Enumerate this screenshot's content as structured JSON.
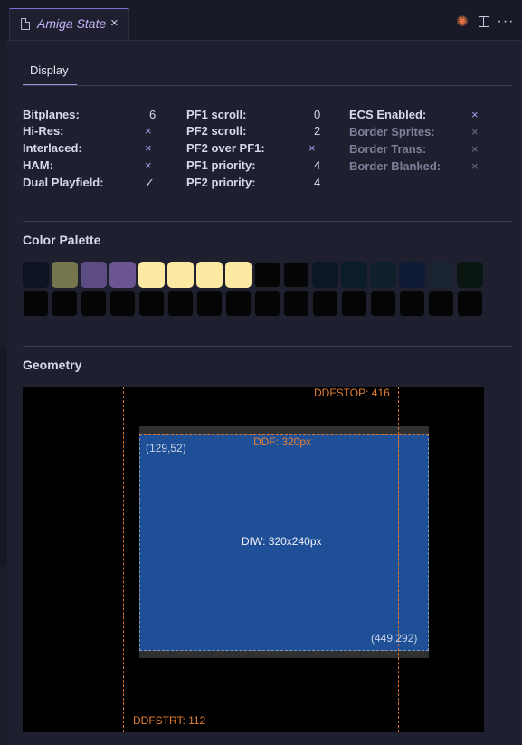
{
  "tab": {
    "title": "Amiga State",
    "close": "×"
  },
  "toolbar": {
    "spark": "✺",
    "more": "···"
  },
  "panel_tab": "Display",
  "display": {
    "col1": [
      {
        "label": "Bitplanes:",
        "value": "6",
        "kind": "text"
      },
      {
        "label": "Hi-Res:",
        "value": "×",
        "kind": "x"
      },
      {
        "label": "Interlaced:",
        "value": "×",
        "kind": "x"
      },
      {
        "label": "HAM:",
        "value": "×",
        "kind": "x"
      },
      {
        "label": "Dual Playfield:",
        "value": "✓",
        "kind": "check"
      }
    ],
    "col2": [
      {
        "label": "PF1 scroll:",
        "value": "0",
        "kind": "text"
      },
      {
        "label": "PF2 scroll:",
        "value": "2",
        "kind": "text"
      },
      {
        "label": "PF2 over PF1:",
        "value": "×",
        "kind": "x"
      },
      {
        "label": "PF1 priority:",
        "value": "4",
        "kind": "text"
      },
      {
        "label": "PF2 priority:",
        "value": "4",
        "kind": "text"
      }
    ],
    "col3": [
      {
        "label": "ECS Enabled:",
        "value": "×",
        "kind": "x",
        "dim": false
      },
      {
        "label": "Border Sprites:",
        "value": "×",
        "kind": "x",
        "dim": true
      },
      {
        "label": "Border Trans:",
        "value": "×",
        "kind": "x",
        "dim": true
      },
      {
        "label": "Border Blanked:",
        "value": "×",
        "kind": "x",
        "dim": true
      }
    ]
  },
  "palette": {
    "title": "Color Palette",
    "colors": [
      "#0d1320",
      "#75764e",
      "#5d4c84",
      "#6b5691",
      "#fce9a2",
      "#fce9a2",
      "#fce9a2",
      "#fce9a2",
      "#050505",
      "#050505",
      "#0b1824",
      "#0b1c2b",
      "#10202b",
      "#0f1a35",
      "#1a2531",
      "#0a1612",
      "#050505",
      "#050505",
      "#050505",
      "#050505",
      "#050505",
      "#050505",
      "#050505",
      "#050505",
      "#050505",
      "#050505",
      "#050505",
      "#050505",
      "#050505",
      "#050505",
      "#050505",
      "#050505"
    ]
  },
  "geometry": {
    "title": "Geometry",
    "ddfstop_label": "DDFSTOP: 416",
    "ddfstrt_label": "DDFSTRT: 112",
    "ddf_label": "DDF: 320px",
    "diw_label": "DIW: 320x240px",
    "top_left": "(129,52)",
    "bottom_right": "(449,292)"
  },
  "colors": {
    "accent": "#c7b4f7",
    "orange": "#e38035",
    "diw_fill": "#1f4f96",
    "bg": "#1e2030"
  }
}
